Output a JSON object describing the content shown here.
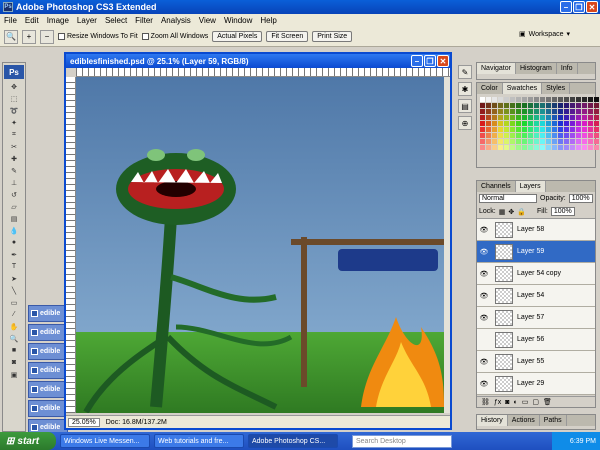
{
  "app": {
    "title": "Adobe Photoshop CS3 Extended",
    "logo": "Ps"
  },
  "menu": [
    "File",
    "Edit",
    "Image",
    "Layer",
    "Select",
    "Filter",
    "Analysis",
    "View",
    "Window",
    "Help"
  ],
  "options": {
    "resize_label": "Resize Windows To Fit",
    "zoom_all_label": "Zoom All Windows",
    "actual_pixels": "Actual Pixels",
    "fit_screen": "Fit Screen",
    "print_size": "Print Size",
    "workspace": "Workspace"
  },
  "minidocs": [
    "edible",
    "edible",
    "edible",
    "edible",
    "edible",
    "edible",
    "edible"
  ],
  "document": {
    "title": "ediblesfinished.psd @ 25.1% (Layer 59, RGB/8)",
    "zoom": "25.05%",
    "doc_info": "Doc: 16.8M/137.2M"
  },
  "navigator_tabs": [
    "Navigator",
    "Histogram",
    "Info"
  ],
  "swatch_tabs": [
    "Color",
    "Swatches",
    "Styles"
  ],
  "layers_tabs": [
    "Channels",
    "Layers"
  ],
  "layers": {
    "blend_mode": "Normal",
    "opacity_label": "Opacity:",
    "opacity": "100%",
    "lock_label": "Lock:",
    "fill_label": "Fill:",
    "fill": "100%",
    "items": [
      {
        "name": "Layer 58",
        "selected": false,
        "visible": true
      },
      {
        "name": "Layer 59",
        "selected": true,
        "visible": true
      },
      {
        "name": "Layer 54 copy",
        "selected": false,
        "visible": true
      },
      {
        "name": "Layer 54",
        "selected": false,
        "visible": true
      },
      {
        "name": "Layer 57",
        "selected": false,
        "visible": true
      },
      {
        "name": "Layer 56",
        "selected": false,
        "visible": false
      },
      {
        "name": "Layer 55",
        "selected": false,
        "visible": true
      },
      {
        "name": "Layer 29",
        "selected": false,
        "visible": true
      }
    ]
  },
  "history_tabs": [
    "History",
    "Actions",
    "Paths"
  ],
  "taskbar": {
    "start": "start",
    "items": [
      "Windows Live Messen...",
      "Web tutorials and fre...",
      "Adobe Photoshop CS..."
    ],
    "search_placeholder": "Search Desktop",
    "clock": "6:39 PM"
  },
  "colors": {
    "xp_blue": "#0a4ad0",
    "selection": "#316ac5",
    "sky": "#5a83b0",
    "grass": "#3f9a2c"
  }
}
